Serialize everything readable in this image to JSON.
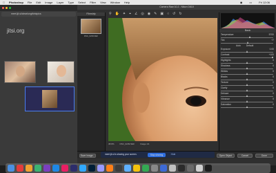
{
  "menubar": {
    "app_name": "Photoshop",
    "items": [
      "File",
      "Edit",
      "Image",
      "Layer",
      "Type",
      "Select",
      "Filter",
      "View",
      "Window",
      "Help"
    ],
    "clock": "Fri 12:06"
  },
  "browser": {
    "url": "meet.jit.si/clearlongthinkpics",
    "brand": "jitsi.org"
  },
  "camera_raw": {
    "window_title": "Camera Raw 10.2 - Nikon D610",
    "filmstrip_header": "Filmstrip",
    "thumbnail_caption": "DSC_0239.NEF",
    "panel_tab": "Basic",
    "sliders": [
      {
        "label": "Temperature",
        "value": "5700",
        "pos": 0.55
      },
      {
        "label": "Tint",
        "value": "+7",
        "pos": 0.52
      },
      {
        "label": "Exposure",
        "value": "0.00",
        "pos": 0.5
      },
      {
        "label": "Contrast",
        "value": "+100",
        "pos": 1.0
      },
      {
        "label": "Highlights",
        "value": "0",
        "pos": 0.5
      },
      {
        "label": "Shadows",
        "value": "0",
        "pos": 0.5
      },
      {
        "label": "Whites",
        "value": "0",
        "pos": 0.5
      },
      {
        "label": "Blacks",
        "value": "0",
        "pos": 0.5
      },
      {
        "label": "Texture",
        "value": "0",
        "pos": 0.5
      },
      {
        "label": "Clarity",
        "value": "0",
        "pos": 0.5
      },
      {
        "label": "Dehaze",
        "value": "0",
        "pos": 0.5
      },
      {
        "label": "Vibrance",
        "value": "0",
        "pos": 0.5
      },
      {
        "label": "Saturation",
        "value": "0",
        "pos": 0.5
      }
    ],
    "auto_label": "Auto",
    "default_label": "Default",
    "zoom": "38.8%",
    "filename": "DSC_0239.NEF",
    "image_count": "Image 1/1",
    "save_image": "Save Image...",
    "workflow_info": "sRGB IEC61966-2.1; 8 bit; 6016 by 4016 (24.2MP); 300 ppi",
    "open_object": "Open Object",
    "cancel": "Cancel",
    "done": "Done"
  },
  "notification": {
    "text": "meet.jit.si is sharing your screen.",
    "stop_button": "Stop sharing",
    "hide_button": "Hide"
  },
  "dock_colors": [
    "#4a90e2",
    "#e23b3b",
    "#f0a030",
    "#3cb371",
    "#7a3fbf",
    "#1e88e5",
    "#e91e63",
    "#2d2d6b",
    "#31a8ff",
    "#001e36",
    "#9999ff",
    "#ff7f18",
    "#3c3c3c",
    "#5fb0ff",
    "#f4c20d",
    "#34a853",
    "#888888",
    "#3d6ad6",
    "#c0c0c0",
    "#2b2b2b",
    "#6a6a6a",
    "#d0d0d0",
    "#1d1d1d"
  ]
}
